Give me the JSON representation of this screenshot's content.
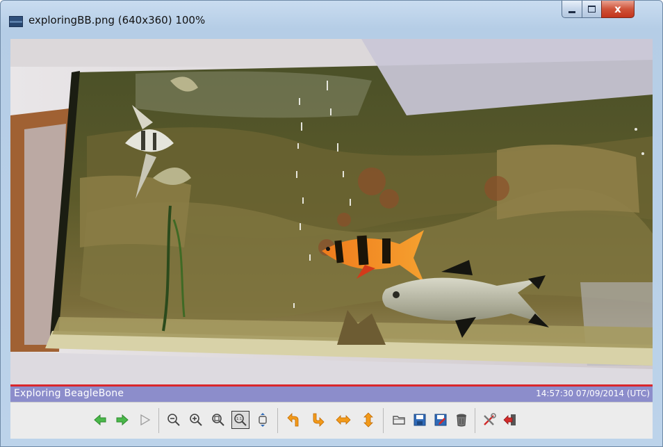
{
  "window": {
    "title": "exploringBB.png (640x360) 100%",
    "close_glyph": "x"
  },
  "status": {
    "left": "Exploring BeagleBone",
    "right": "14:57:30 07/09/2014 (UTC)"
  },
  "toolbar": {
    "buttons": [
      {
        "name": "previous-icon",
        "group": 1
      },
      {
        "name": "next-icon",
        "group": 1
      },
      {
        "name": "play-icon",
        "group": 1
      },
      {
        "name": "zoom-out-icon",
        "group": 2
      },
      {
        "name": "zoom-in-icon",
        "group": 2
      },
      {
        "name": "zoom-fit-icon",
        "group": 2
      },
      {
        "name": "zoom-actual-size-icon",
        "group": 2,
        "active": true
      },
      {
        "name": "fit-window-icon",
        "group": 2
      },
      {
        "name": "rotate-left-icon",
        "group": 3
      },
      {
        "name": "rotate-right-icon",
        "group": 3
      },
      {
        "name": "flip-horizontal-icon",
        "group": 3
      },
      {
        "name": "flip-vertical-icon",
        "group": 3
      },
      {
        "name": "open-folder-icon",
        "group": 4
      },
      {
        "name": "save-icon",
        "group": 4
      },
      {
        "name": "save-as-icon",
        "group": 4
      },
      {
        "name": "delete-icon",
        "group": 4
      },
      {
        "name": "settings-tools-icon",
        "group": 5
      },
      {
        "name": "exit-icon",
        "group": 5
      }
    ],
    "zoom_actual_label": "1:1"
  },
  "colors": {
    "status_bar": "#8c8dcb",
    "status_rule": "#d9262b",
    "arrow_green": "#4ab84a",
    "orange": "#f29a1a",
    "blue": "#2f6ab8",
    "red": "#d22b2b"
  }
}
